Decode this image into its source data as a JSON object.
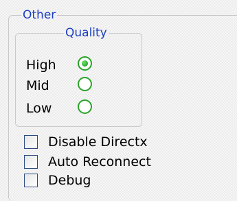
{
  "group_other": {
    "legend": "Other"
  },
  "group_quality": {
    "legend": "Quality",
    "options": [
      {
        "label": "High",
        "selected": true
      },
      {
        "label": "Mid",
        "selected": false
      },
      {
        "label": "Low",
        "selected": false
      }
    ]
  },
  "checkboxes": [
    {
      "label": "Disable Directx",
      "checked": false
    },
    {
      "label": "Auto Reconnect",
      "checked": false
    },
    {
      "label": "Debug",
      "checked": false
    }
  ],
  "colors": {
    "legend_text": "#1c3fc4",
    "radio_accent": "#27a327",
    "checkbox_border": "#2c4e84"
  }
}
